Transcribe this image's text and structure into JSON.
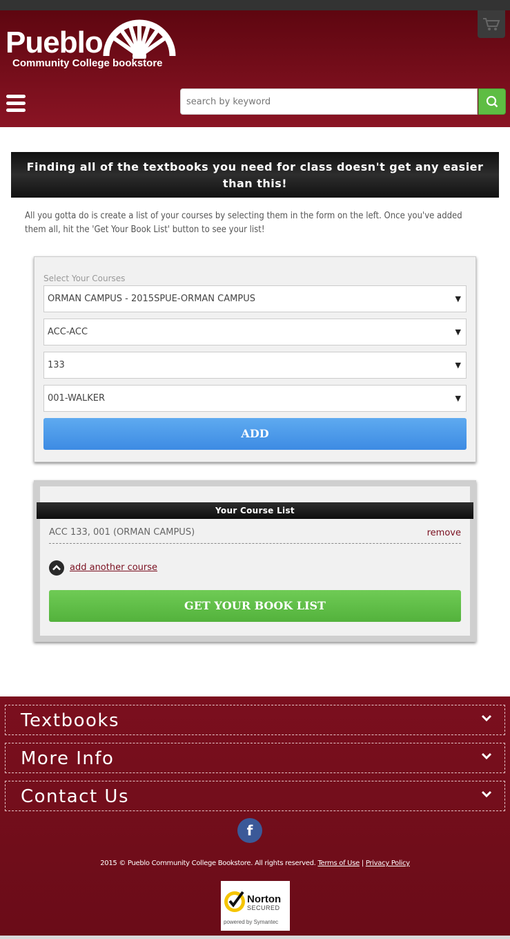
{
  "header": {
    "logo_name": "Pueblo",
    "logo_sub": "Community College bookstore",
    "search_placeholder": "search by keyword"
  },
  "banner": {
    "headline": "Finding all of the textbooks you need for class doesn't get any easier than this!"
  },
  "intro": "All you gotta do is create a list of your courses by selecting them in the form on the left. Once you've added them all, hit the 'Get Your Book List' button to see your list!",
  "course_form": {
    "label": "Select Your Courses",
    "selects": [
      {
        "value": "ORMAN CAMPUS - 2015SPUE-ORMAN CAMPUS"
      },
      {
        "value": "ACC-ACC"
      },
      {
        "value": "133"
      },
      {
        "value": "001-WALKER"
      }
    ],
    "add_label": "ADD"
  },
  "course_list": {
    "title": "Your Course List",
    "items": [
      {
        "course": "ACC 133, 001 (ORMAN CAMPUS)",
        "remove_label": "remove"
      }
    ],
    "add_another_label": "add another course",
    "get_list_label": "GET YOUR BOOK LIST"
  },
  "footer": {
    "sections": [
      "Textbooks",
      "More Info",
      "Contact Us"
    ],
    "copyright": "2015 © Pueblo Community College Bookstore. All rights reserved.",
    "terms_label": "Terms of Use",
    "separator": "|",
    "privacy_label": "Privacy Policy",
    "norton_title": "Norton",
    "norton_secured": "SECURED",
    "norton_powered": "powered by Symantec"
  }
}
